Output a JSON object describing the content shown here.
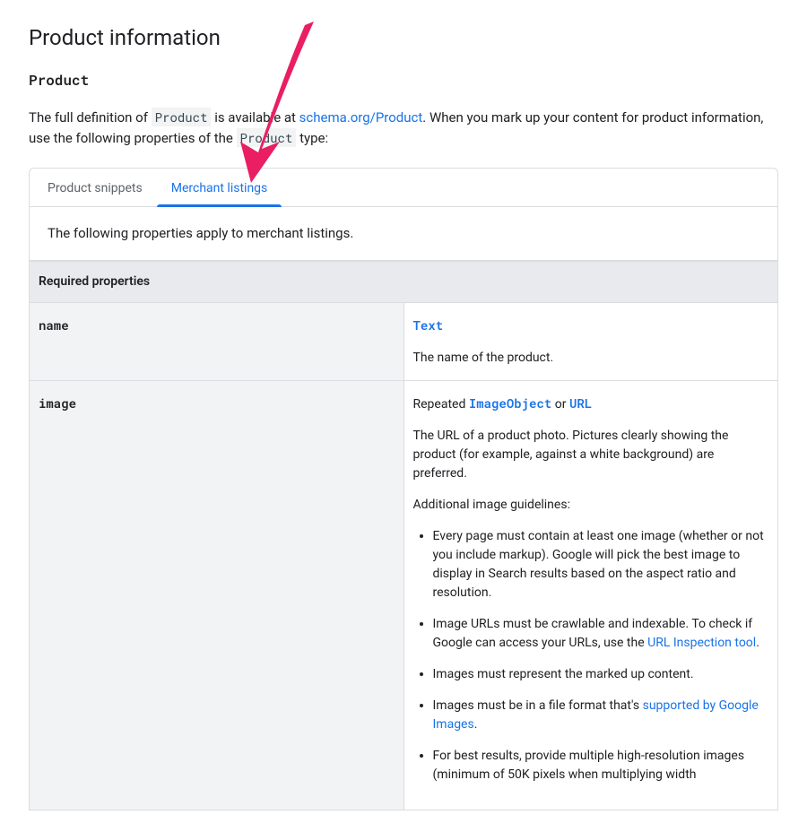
{
  "heading": "Product information",
  "subheading": "Product",
  "intro": {
    "prefix": "The full definition of ",
    "code1": "Product",
    "mid1": " is available at ",
    "link1": "schema.org/Product",
    "mid2": ". When you mark up your content for product information, use the following properties of the ",
    "code2": "Product",
    "suffix": " type:"
  },
  "tabs": {
    "t0": "Product snippets",
    "t1": "Merchant listings"
  },
  "tab_body": "The following properties apply to merchant listings.",
  "section_header": "Required properties",
  "rows": {
    "name": {
      "prop": "name",
      "type_link": "Text",
      "desc": "The name of the product."
    },
    "image": {
      "prop": "image",
      "type_prefix": "Repeated ",
      "type_link1": "ImageObject",
      "type_mid": " or ",
      "type_link2": "URL",
      "desc1": "The URL of a product photo. Pictures clearly showing the product (for example, against a white background) are preferred.",
      "desc2": "Additional image guidelines:",
      "bullets": {
        "b0": "Every page must contain at least one image (whether or not you include markup). Google will pick the best image to display in Search results based on the aspect ratio and resolution.",
        "b1_a": "Image URLs must be crawlable and indexable. To check if Google can access your URLs, use the ",
        "b1_link": "URL Inspection tool",
        "b1_b": ".",
        "b2": "Images must represent the marked up content.",
        "b3_a": "Images must be in a file format that's ",
        "b3_link": "supported by Google Images",
        "b3_b": ".",
        "b4": "For best results, provide multiple high-resolution images (minimum of 50K pixels when multiplying width"
      }
    }
  },
  "annotation": {
    "arrow_color": "#e91e63"
  }
}
